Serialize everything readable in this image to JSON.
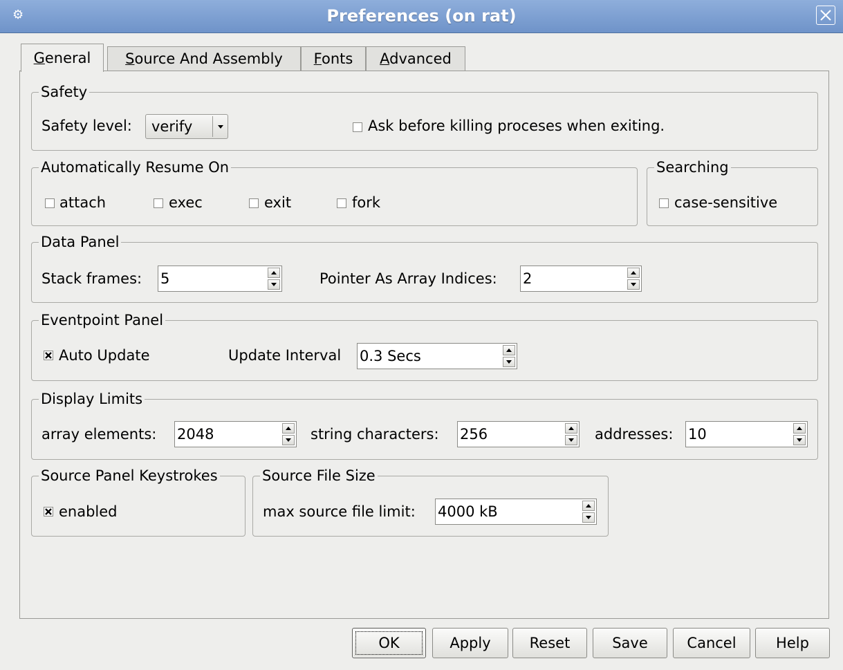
{
  "window": {
    "title": "Preferences (on rat)"
  },
  "tabs": [
    {
      "label": "General",
      "mnemonic": "G",
      "rest": "eneral"
    },
    {
      "label": "Source And Assembly",
      "mnemonic": "S",
      "rest": "ource And Assembly"
    },
    {
      "label": "Fonts",
      "mnemonic": "F",
      "rest": "onts"
    },
    {
      "label": "Advanced",
      "mnemonic": "A",
      "rest": "dvanced"
    }
  ],
  "safety": {
    "legend": "Safety",
    "level_label": "Safety level:",
    "level_value": "verify",
    "ask_label": "Ask before killing proceses when exiting.",
    "ask_checked": false
  },
  "auto_resume": {
    "legend": "Automatically Resume On",
    "items": [
      {
        "label": "attach",
        "checked": false
      },
      {
        "label": "exec",
        "checked": false
      },
      {
        "label": "exit",
        "checked": false
      },
      {
        "label": "fork",
        "checked": false
      }
    ]
  },
  "searching": {
    "legend": "Searching",
    "case_label": "case-sensitive",
    "case_checked": false
  },
  "data_panel": {
    "legend": "Data Panel",
    "stack_label": "Stack frames:",
    "stack_value": "5",
    "pointer_label": "Pointer As Array Indices:",
    "pointer_value": "2"
  },
  "eventpoint_panel": {
    "legend": "Eventpoint Panel",
    "auto_update_label": "Auto Update",
    "auto_update_checked": true,
    "interval_label": "Update Interval",
    "interval_value": "0.3 Secs"
  },
  "display_limits": {
    "legend": "Display Limits",
    "array_label": "array elements:",
    "array_value": "2048",
    "string_label": "string characters:",
    "string_value": "256",
    "addresses_label": "addresses:",
    "addresses_value": "10"
  },
  "source_keystrokes": {
    "legend": "Source Panel Keystrokes",
    "enabled_label": "enabled",
    "enabled_checked": true
  },
  "source_file_size": {
    "legend": "Source File Size",
    "limit_label": "max source file limit:",
    "limit_value": "4000 kB"
  },
  "buttons": {
    "ok": "OK",
    "apply": "Apply",
    "reset": "Reset",
    "save": "Save",
    "cancel": "Cancel",
    "help": "Help"
  }
}
